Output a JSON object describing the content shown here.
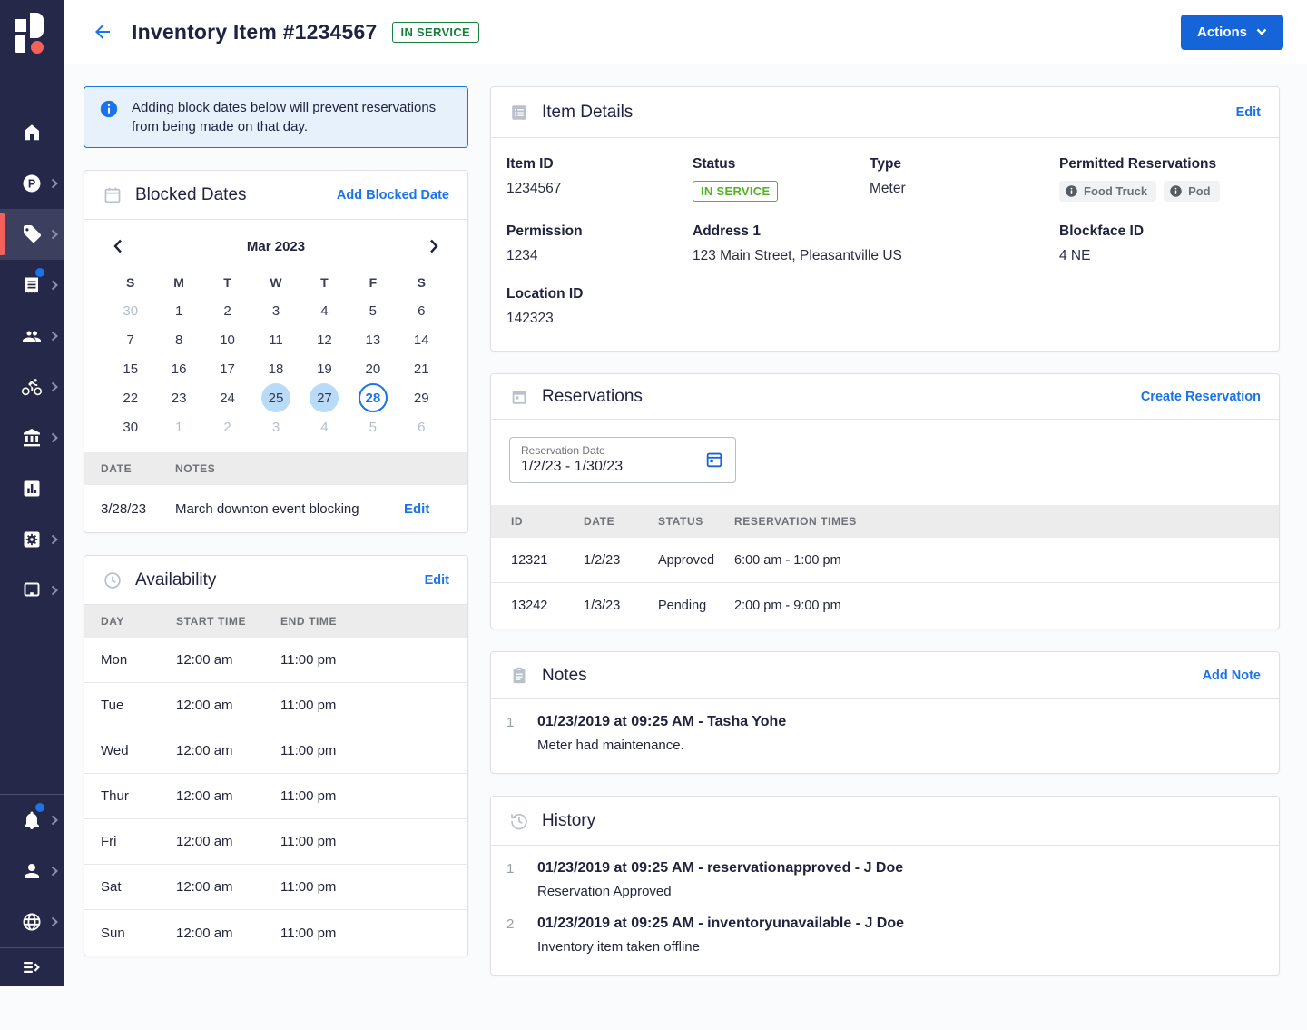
{
  "colors": {
    "accent_blue": "#1565d8",
    "link_blue": "#1a73e8",
    "sidebar_bg": "#262849",
    "sidebar_active_red": "#f4605a",
    "badge_green_dark": "#17803d",
    "badge_green_light": "#54b223",
    "alert_bg": "#e7f1fc",
    "blocked_day_bg": "#badbf7"
  },
  "header": {
    "title": "Inventory Item #1234567",
    "status_badge": "IN SERVICE",
    "actions_label": "Actions"
  },
  "sidebar": {
    "items": [
      {
        "icon": "home-icon",
        "chevron": false,
        "active": false,
        "dot": false
      },
      {
        "icon": "parking-icon",
        "chevron": true,
        "active": false,
        "dot": false
      },
      {
        "icon": "tag-icon",
        "chevron": true,
        "active": true,
        "dot": false
      },
      {
        "icon": "receipt-icon",
        "chevron": true,
        "active": false,
        "dot": true
      },
      {
        "icon": "people-icon",
        "chevron": true,
        "active": false,
        "dot": false
      },
      {
        "icon": "bike-icon",
        "chevron": true,
        "active": false,
        "dot": false
      },
      {
        "icon": "bank-icon",
        "chevron": true,
        "active": false,
        "dot": false
      },
      {
        "icon": "bar-chart-icon",
        "chevron": false,
        "active": false,
        "dot": false
      },
      {
        "icon": "settings-icon",
        "chevron": true,
        "active": false,
        "dot": false
      },
      {
        "icon": "monitor-icon",
        "chevron": true,
        "active": false,
        "dot": false
      }
    ],
    "bottom_items": [
      {
        "icon": "bell-icon",
        "chevron": true,
        "active": false,
        "dot": true
      },
      {
        "icon": "person-icon",
        "chevron": true,
        "active": false,
        "dot": false
      },
      {
        "icon": "globe-icon",
        "chevron": true,
        "active": false,
        "dot": false
      }
    ],
    "expand_icon": "expand-menu-icon"
  },
  "alert": {
    "text": "Adding block dates below will prevent reservations from being made on that day."
  },
  "blocked_dates": {
    "title": "Blocked Dates",
    "action": "Add Blocked Date",
    "calendar": {
      "month_label": "Mar 2023",
      "day_headers": [
        "S",
        "M",
        "T",
        "W",
        "T",
        "F",
        "S"
      ],
      "weeks": [
        [
          {
            "d": "30",
            "state": "muted"
          },
          {
            "d": "1",
            "state": ""
          },
          {
            "d": "2",
            "state": ""
          },
          {
            "d": "3",
            "state": ""
          },
          {
            "d": "4",
            "state": ""
          },
          {
            "d": "5",
            "state": ""
          },
          {
            "d": "6",
            "state": ""
          }
        ],
        [
          {
            "d": "7",
            "state": ""
          },
          {
            "d": "8",
            "state": ""
          },
          {
            "d": "10",
            "state": ""
          },
          {
            "d": "11",
            "state": ""
          },
          {
            "d": "12",
            "state": ""
          },
          {
            "d": "13",
            "state": ""
          },
          {
            "d": "14",
            "state": ""
          }
        ],
        [
          {
            "d": "15",
            "state": ""
          },
          {
            "d": "16",
            "state": ""
          },
          {
            "d": "17",
            "state": ""
          },
          {
            "d": "18",
            "state": ""
          },
          {
            "d": "19",
            "state": ""
          },
          {
            "d": "20",
            "state": ""
          },
          {
            "d": "21",
            "state": ""
          }
        ],
        [
          {
            "d": "22",
            "state": ""
          },
          {
            "d": "23",
            "state": ""
          },
          {
            "d": "24",
            "state": ""
          },
          {
            "d": "25",
            "state": "blocked"
          },
          {
            "d": "27",
            "state": "blocked"
          },
          {
            "d": "28",
            "state": "selected"
          },
          {
            "d": "29",
            "state": ""
          }
        ],
        [
          {
            "d": "30",
            "state": ""
          },
          {
            "d": "1",
            "state": "muted"
          },
          {
            "d": "2",
            "state": "muted"
          },
          {
            "d": "3",
            "state": "muted"
          },
          {
            "d": "4",
            "state": "muted"
          },
          {
            "d": "5",
            "state": "muted"
          },
          {
            "d": "6",
            "state": "muted"
          }
        ]
      ]
    },
    "table": {
      "headers": [
        "DATE",
        "NOTES"
      ],
      "rows": [
        {
          "date": "3/28/23",
          "notes": "March downton event blocking",
          "action": "Edit"
        }
      ]
    }
  },
  "availability": {
    "title": "Availability",
    "action": "Edit",
    "headers": [
      "DAY",
      "START TIME",
      "END TIME"
    ],
    "rows": [
      {
        "day": "Mon",
        "start": "12:00 am",
        "end": "11:00 pm"
      },
      {
        "day": "Tue",
        "start": "12:00 am",
        "end": "11:00 pm"
      },
      {
        "day": "Wed",
        "start": "12:00 am",
        "end": "11:00 pm"
      },
      {
        "day": "Thur",
        "start": "12:00 am",
        "end": "11:00 pm"
      },
      {
        "day": "Fri",
        "start": "12:00 am",
        "end": "11:00 pm"
      },
      {
        "day": "Sat",
        "start": "12:00 am",
        "end": "11:00 pm"
      },
      {
        "day": "Sun",
        "start": "12:00 am",
        "end": "11:00 pm"
      }
    ]
  },
  "item_details": {
    "title": "Item Details",
    "action": "Edit",
    "fields": {
      "item_id": {
        "label": "Item ID",
        "value": "1234567"
      },
      "status": {
        "label": "Status",
        "value": "IN SERVICE"
      },
      "type": {
        "label": "Type",
        "value": "Meter"
      },
      "permitted": {
        "label": "Permitted Reservations",
        "chips": [
          "Food Truck",
          "Pod"
        ]
      },
      "permission": {
        "label": "Permission",
        "value": "1234"
      },
      "address": {
        "label": "Address 1",
        "value": "123 Main Street, Pleasantville US"
      },
      "blockface": {
        "label": "Blockface ID",
        "value": "4 NE"
      },
      "location": {
        "label": "Location ID",
        "value": "142323"
      }
    }
  },
  "reservations": {
    "title": "Reservations",
    "action": "Create Reservation",
    "filter": {
      "label": "Reservation Date",
      "value": "1/2/23 - 1/30/23"
    },
    "headers": [
      "ID",
      "DATE",
      "STATUS",
      "RESERVATION TIMES"
    ],
    "rows": [
      {
        "id": "12321",
        "date": "1/2/23",
        "status": "Approved",
        "times": "6:00 am - 1:00 pm"
      },
      {
        "id": "13242",
        "date": "1/3/23",
        "status": "Pending",
        "times": "2:00 pm - 9:00 pm"
      }
    ]
  },
  "notes": {
    "title": "Notes",
    "action": "Add Note",
    "entries": [
      {
        "num": "1",
        "heading": "01/23/2019 at 09:25 AM - Tasha Yohe",
        "body": "Meter had maintenance."
      }
    ]
  },
  "history": {
    "title": "History",
    "entries": [
      {
        "num": "1",
        "heading": "01/23/2019 at 09:25 AM - reservationapproved - J Doe",
        "body": "Reservation Approved"
      },
      {
        "num": "2",
        "heading": "01/23/2019 at 09:25 AM - inventoryunavailable - J Doe",
        "body": "Inventory item taken offline"
      }
    ]
  }
}
